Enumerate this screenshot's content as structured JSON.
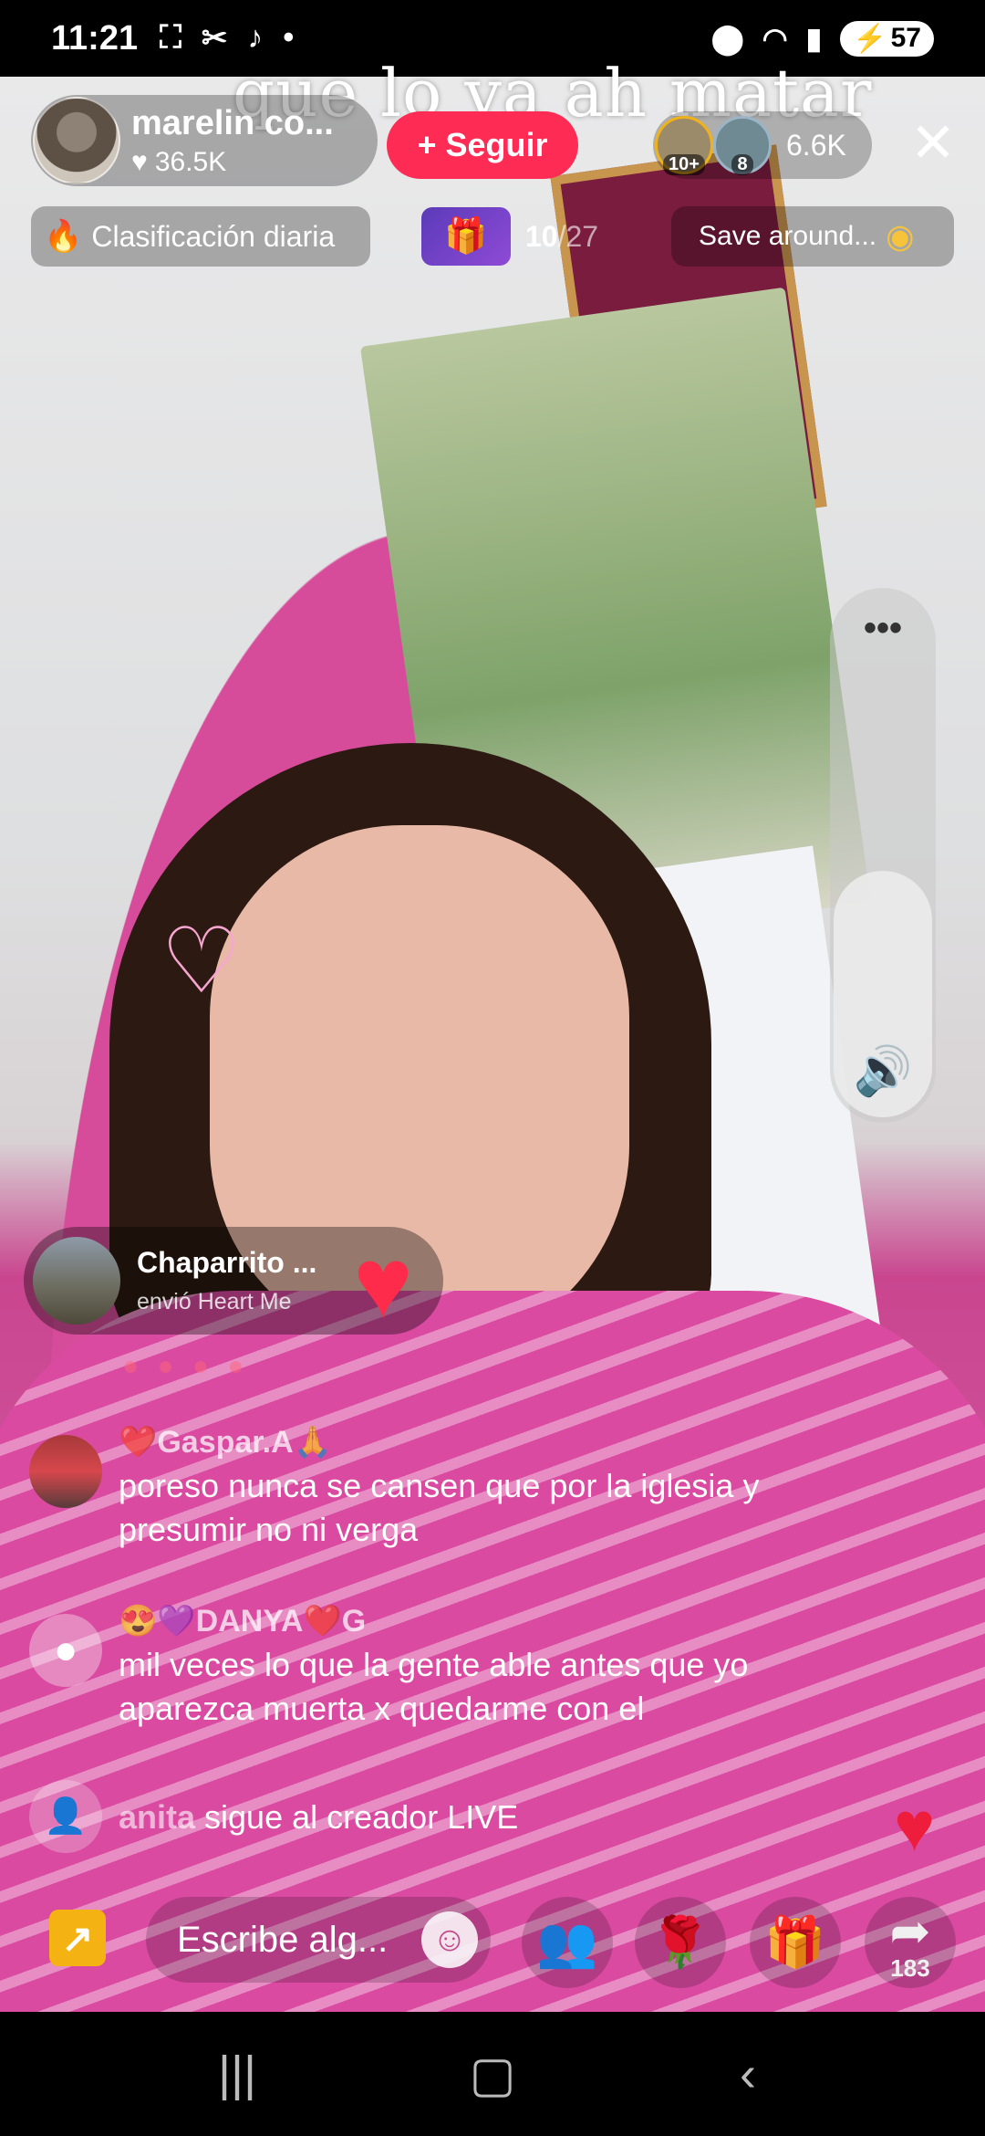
{
  "status_bar": {
    "time": "11:21",
    "left_icons": [
      "screen-record-icon",
      "missed-call-icon",
      "tiktok-icon",
      "dot-icon"
    ],
    "right_icons": [
      "location-icon",
      "wifi-icon",
      "signal-icon"
    ],
    "battery": "57"
  },
  "caption": "que lo va ah matar",
  "host": {
    "name": "marelin co...",
    "likes": "36.5K",
    "follow_label": "+ Seguir"
  },
  "viewers": {
    "badges": [
      "10+",
      "8"
    ],
    "count": "6.6K"
  },
  "ranking": {
    "label": "Clasificación diaria"
  },
  "gift_goal": {
    "current": "10",
    "total": "/27"
  },
  "save_around": {
    "label": "Save around..."
  },
  "gift_notice": {
    "name": "Chaparrito ...",
    "text": "envió Heart Me"
  },
  "comments": [
    {
      "user": "❤️Gaspar.A🙏",
      "message": "poreso nunca se cansen que por la iglesia y presumir no ni verga"
    },
    {
      "user": "😍💜DANYA❤️G",
      "message": "mil veces lo que la gente able antes que yo aparezca muerta x quedarme con el"
    }
  ],
  "follow_event": {
    "user": "anita",
    "text": " sigue al creador LIVE"
  },
  "action_bar": {
    "input_placeholder": "Escribe alg...",
    "share_count": "183"
  },
  "colors": {
    "follow_button": "#fe2c55",
    "accent_pink": "#d94aa0"
  }
}
